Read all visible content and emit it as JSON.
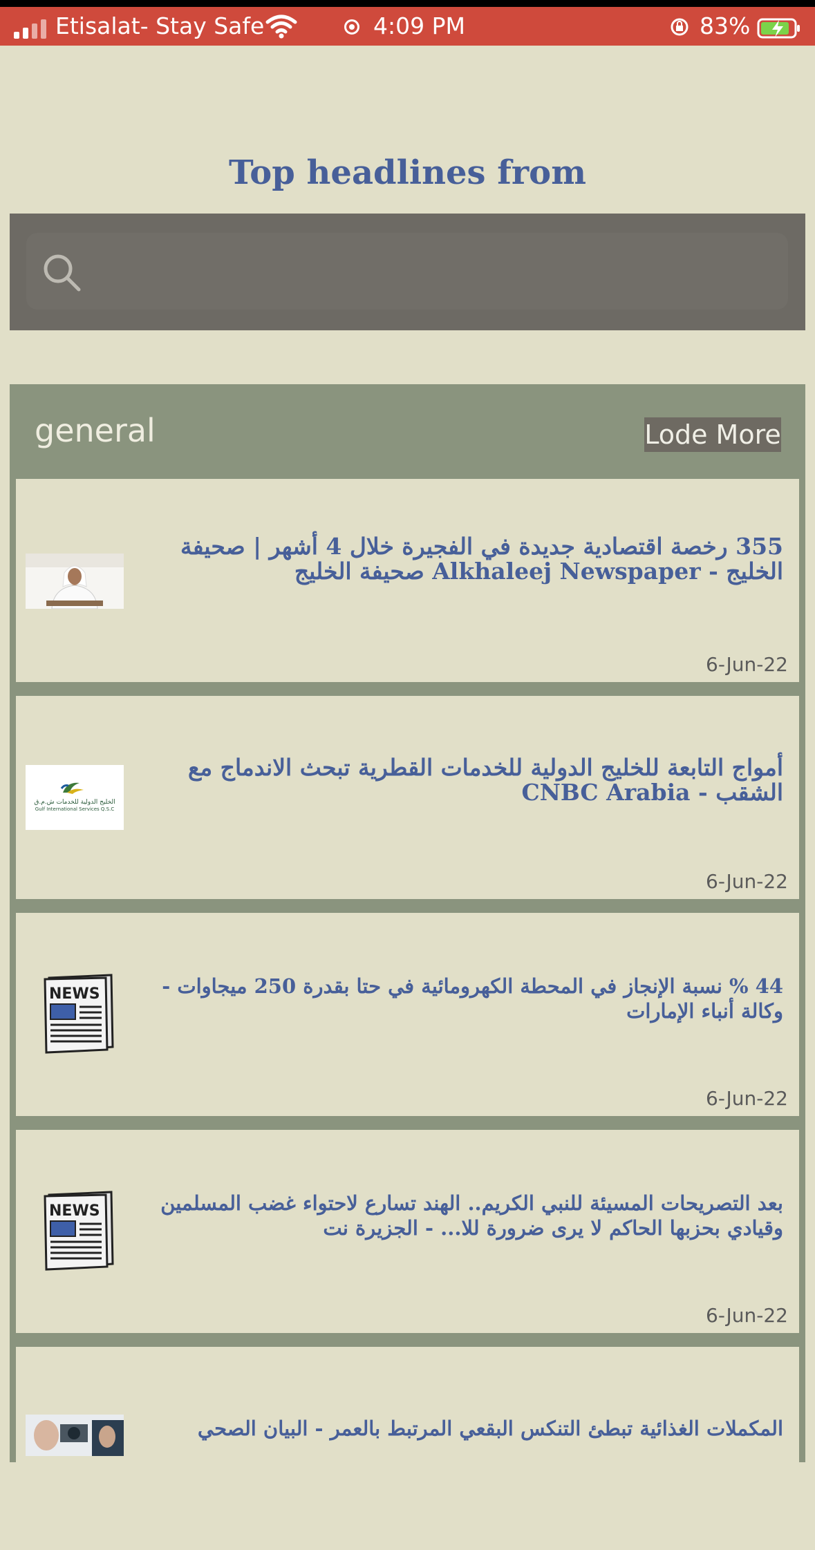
{
  "status_bar": {
    "carrier": "Etisalat- Stay Safe",
    "time": "4:09 PM",
    "battery_percent": "83%"
  },
  "header": {
    "title": "Top headlines from"
  },
  "search": {
    "placeholder": "",
    "value": ""
  },
  "section": {
    "title": "general",
    "load_more_label": "Lode More"
  },
  "articles": [
    {
      "title": "355 رخصة اقتصادية جديدة في الفجيرة خلال 4 أشهر | صحيفة الخليج - Alkhaleej Newspaper صحيفة الخليج",
      "date": "6-Jun-22",
      "thumbnail": "photo-man"
    },
    {
      "title": "أمواج التابعة للخليج الدولية للخدمات القطرية تبحث الاندماج مع الشقب - CNBC Arabia",
      "date": "6-Jun-22",
      "thumbnail": "gulf-international-logo",
      "logo_text_ar": "الخليج الدولية للخدمات ش.م.ق",
      "logo_text_en": "Gulf International Services Q.S.C"
    },
    {
      "title": "44 % نسبة الإنجاز في المحطة الكهرومائية في حتا بقدرة 250 ميجاوات - وكالة أنباء الإمارات",
      "date": "6-Jun-22",
      "thumbnail": "news-icon",
      "icon_text": "NEWS"
    },
    {
      "title": "بعد التصريحات المسيئة للنبي الكريم.. الهند تسارع لاحتواء غضب المسلمين وقيادي بحزبها الحاكم لا يرى ضرورة للا... - الجزيرة نت",
      "date": "6-Jun-22",
      "thumbnail": "news-icon",
      "icon_text": "NEWS"
    },
    {
      "title": "المكملات الغذائية تبطئ التنكس البقعي المرتبط بالعمر - البيان الصحي",
      "date": "",
      "thumbnail": "photo-eye-exam"
    }
  ],
  "colors": {
    "status_bar": "#cf4a3c",
    "background": "#e1dfc8",
    "accent_text": "#475f99",
    "section_band": "#8a947e",
    "search_band": "#6d6a64"
  }
}
